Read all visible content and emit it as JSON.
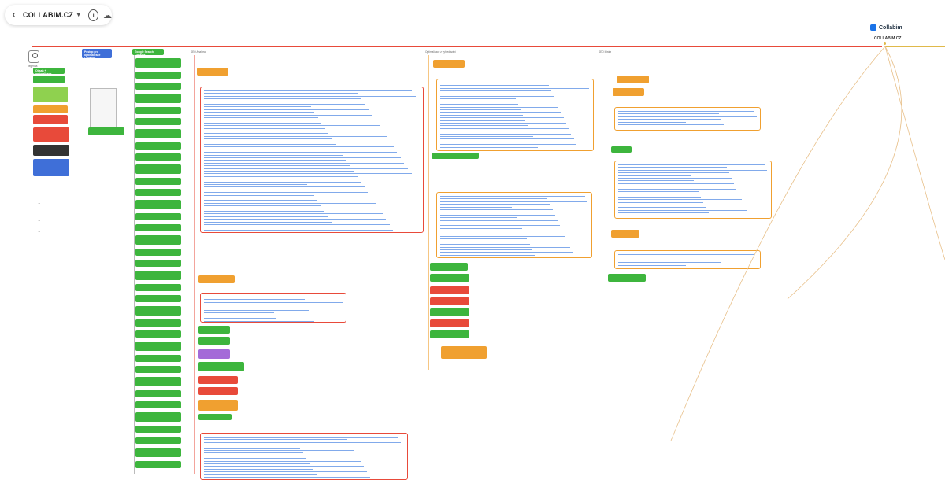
{
  "toolbar": {
    "back_icon": "chevron-left-icon",
    "title": "COLLABIM.CZ",
    "dropdown_icon": "chevron-down-icon",
    "info_icon": "info-icon",
    "cloud_icon": "cloud-upload-icon"
  },
  "brand": {
    "logo_text": "Collabim",
    "root_label": "COLLABIM.CZ"
  },
  "legend": {
    "label": "legenda"
  },
  "columns": {
    "col1_header": "Obsah + optimalizace",
    "col2_header": "Postup pro optimalizace Collabim",
    "col3_header": "Google Search Console",
    "col4_header": "SEO Analýza",
    "col5_header": "Optimalizace z vyhledávání",
    "col6_header": "SEO Mistrz"
  },
  "colors": {
    "green": "#3db53d",
    "blue": "#3f6fd8",
    "orange": "#f0a030",
    "red": "#e84a3a",
    "dark": "#333333",
    "purple": "#a46ad8",
    "link": "#6b9be8"
  }
}
